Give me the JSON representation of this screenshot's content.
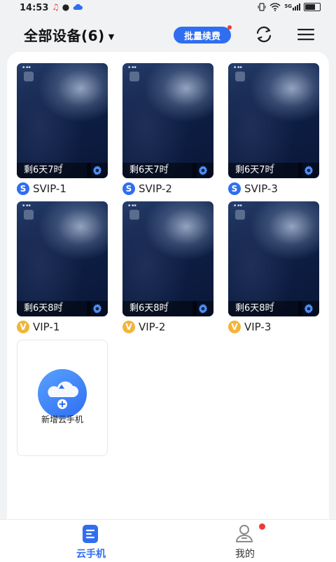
{
  "status_bar": {
    "time": "14:53",
    "left_icons": [
      "music-icon",
      "chat-icon",
      "cloud-icon"
    ],
    "right_icons": [
      "vibrate-icon",
      "wifi-icon",
      "5g-signal-icon",
      "battery-icon"
    ],
    "network": "5G"
  },
  "header": {
    "title": "全部设备(6)",
    "renew_button": "批量续费",
    "icons": [
      "refresh-icon",
      "menu-icon"
    ]
  },
  "devices": [
    {
      "time_left": "剩6天7时",
      "badge": "S",
      "name": "SVIP-1"
    },
    {
      "time_left": "剩6天7时",
      "badge": "S",
      "name": "SVIP-2"
    },
    {
      "time_left": "剩6天7时",
      "badge": "S",
      "name": "SVIP-3"
    },
    {
      "time_left": "剩6天8时",
      "badge": "V",
      "name": "VIP-1"
    },
    {
      "time_left": "剩6天8时",
      "badge": "V",
      "name": "VIP-2"
    },
    {
      "time_left": "剩6天8时",
      "badge": "V",
      "name": "VIP-3"
    }
  ],
  "add_device": {
    "label": "新增云手机"
  },
  "tabs": [
    {
      "label": "云手机",
      "icon": "cloud-phone-icon",
      "active": true
    },
    {
      "label": "我的",
      "icon": "user-icon",
      "active": false
    }
  ],
  "colors": {
    "accent": "#2f6ef1",
    "svip_badge": "#2f6ef1",
    "vip_badge": "#f2b53a",
    "notification_dot": "#e93c3c"
  }
}
